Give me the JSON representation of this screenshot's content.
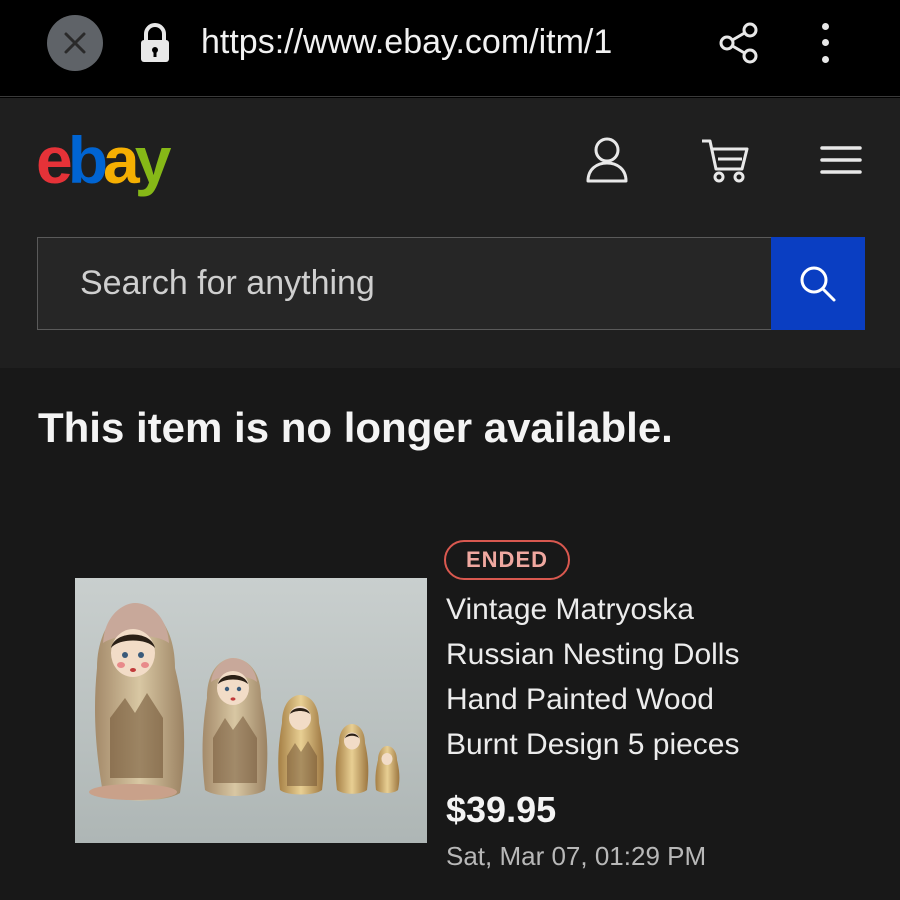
{
  "browser": {
    "url": "https://www.ebay.com/itm/1",
    "icons": [
      "close-icon",
      "lock-icon",
      "share-icon",
      "more-vert-icon"
    ]
  },
  "header": {
    "logo": {
      "e": "e",
      "b": "b",
      "a": "a",
      "y": "y"
    },
    "logo_colors": {
      "e": "#e53238",
      "b": "#0064d2",
      "a": "#f5af02",
      "y": "#86b817"
    },
    "icons": [
      "user-icon",
      "cart-icon",
      "hamburger-icon"
    ]
  },
  "search": {
    "placeholder": "Search for anything",
    "button_color": "#0a3ec2"
  },
  "main": {
    "headline": "This item is no longer available."
  },
  "item": {
    "status": "ENDED",
    "title_lines": [
      "Vintage Matryoska",
      "Russian Nesting Dolls",
      "Hand Painted Wood",
      "Burnt Design 5 pieces"
    ],
    "price": "$39.95",
    "date": "Sat, Mar 07, 01:29 PM"
  }
}
